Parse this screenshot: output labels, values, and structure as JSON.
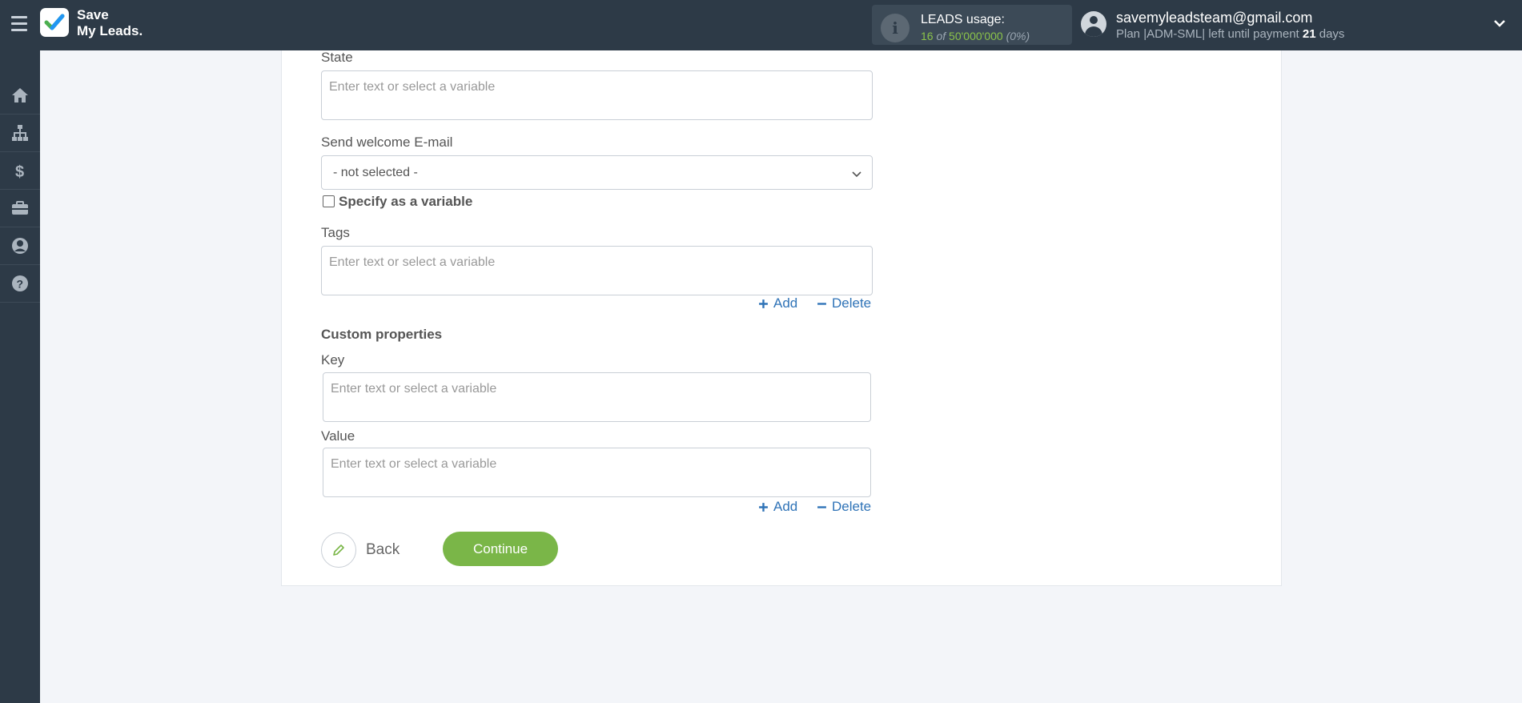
{
  "header": {
    "logo_line1": "Save",
    "logo_line2": "My Leads",
    "logo_dot": ".",
    "usage_title": "LEADS usage:",
    "usage_count": "16",
    "usage_of": "of",
    "usage_total": "50'000'000",
    "usage_pct": "(0%)",
    "user_email": "savemyleadsteam@gmail.com",
    "plan_prefix": "Plan |ADM-SML| left until payment",
    "plan_days": "21",
    "plan_suffix": "days"
  },
  "sidebar": {
    "items": [
      "home-icon",
      "sitemap-icon",
      "dollar-icon",
      "briefcase-icon",
      "user-icon",
      "help-icon"
    ]
  },
  "form": {
    "state_label": "State",
    "state_placeholder": "Enter text or select a variable",
    "welcome_label": "Send welcome E-mail",
    "welcome_value": "- not selected -",
    "specify_variable_label": "Specify as a variable",
    "tags_label": "Tags",
    "tags_placeholder": "Enter text or select a variable",
    "add_label": "Add",
    "delete_label": "Delete",
    "custom_properties_label": "Custom properties",
    "key_label": "Key",
    "key_placeholder": "Enter text or select a variable",
    "value_label": "Value",
    "value_placeholder": "Enter text or select a variable",
    "back_label": "Back",
    "continue_label": "Continue"
  },
  "colors": {
    "topbar": "#2d3a47",
    "accent_green": "#7ab648",
    "link_blue": "#2f73b7"
  }
}
